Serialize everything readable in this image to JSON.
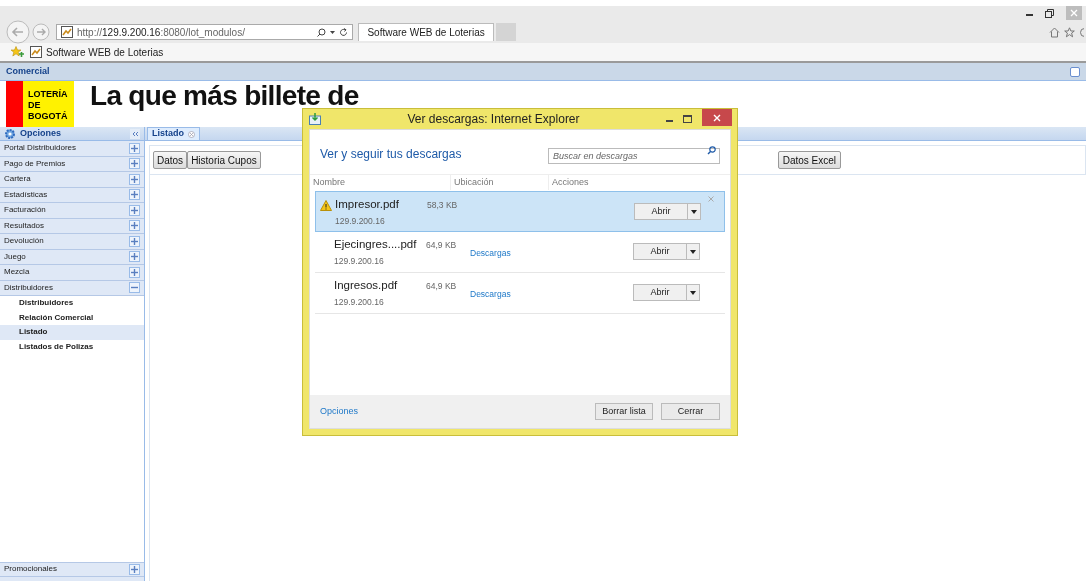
{
  "browser": {
    "address": {
      "prefix": "http://",
      "host": "129.9.200.16",
      "rest": ":8080/lot_modulos/"
    },
    "tab": {
      "title": "Software WEB de Loterias",
      "selected": true
    },
    "favorites": [
      "Software WEB de Loterias"
    ]
  },
  "app_bar": {
    "title": "Comercial"
  },
  "banner": {
    "logo_lines": [
      "LOTERÍA",
      "DE",
      "BOGOTÁ"
    ],
    "headline": "La que más billete de"
  },
  "sidebar": {
    "title": "Opciones",
    "items": [
      {
        "label": "Portal Distribuidores",
        "expanded": false
      },
      {
        "label": "Pago de Premios",
        "expanded": false
      },
      {
        "label": "Cartera",
        "expanded": false
      },
      {
        "label": "Estadísticas",
        "expanded": false
      },
      {
        "label": "Facturación",
        "expanded": false
      },
      {
        "label": "Resultados",
        "expanded": false
      },
      {
        "label": "Devolución",
        "expanded": false
      },
      {
        "label": "Juego",
        "expanded": false
      },
      {
        "label": "Mezcla",
        "expanded": false
      },
      {
        "label": "Distribuidores",
        "expanded": true,
        "children": [
          {
            "label": "Distribuidores",
            "selected": false
          },
          {
            "label": "Relación Comercial",
            "selected": false
          },
          {
            "label": "Listado",
            "selected": true
          },
          {
            "label": "Listados de Polizas",
            "selected": false
          }
        ]
      }
    ],
    "bottom_items": [
      {
        "label": "Promocionales",
        "expanded": false
      }
    ]
  },
  "panel": {
    "tabs": [
      {
        "label": "Listado",
        "selected": true
      }
    ],
    "buttons": [
      "Datos",
      "Historia Cupos"
    ],
    "right_button": "Datos Excel"
  },
  "dialog": {
    "title": "Ver descargas: Internet Explorer",
    "heading": "Ver y seguir tus descargas",
    "search": {
      "placeholder": "Buscar en descargas"
    },
    "columns": [
      "Nombre",
      "Ubicación",
      "Acciones"
    ],
    "downloads": [
      {
        "name": "Impresor.pdf",
        "size": "58,3 KB",
        "source": "129.9.200.16",
        "warning": true,
        "selected": true,
        "action": "Abrir"
      },
      {
        "name": "Ejecingres....pdf",
        "size": "64,9 KB",
        "source": "129.9.200.16",
        "location": "Descargas",
        "warning": false,
        "selected": false,
        "action": "Abrir"
      },
      {
        "name": "Ingresos.pdf",
        "size": "64,9 KB",
        "source": "129.9.200.16",
        "location": "Descargas",
        "warning": false,
        "selected": false,
        "action": "Abrir"
      }
    ],
    "options_link": "Opciones",
    "buttons": [
      "Borrar lista",
      "Cerrar"
    ]
  }
}
